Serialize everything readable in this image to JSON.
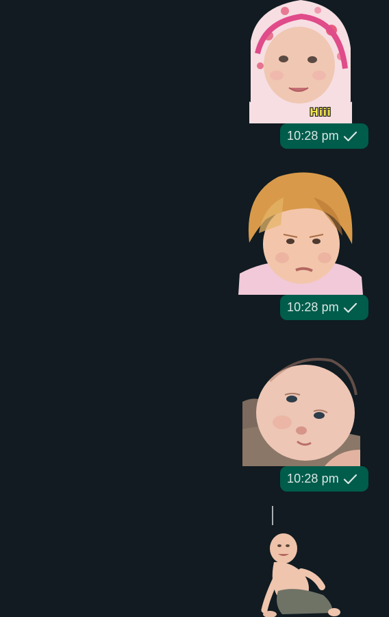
{
  "messages": [
    {
      "sticker": "baby-in-hood-sticker",
      "caption": "Hiii",
      "time": "10:28 pm",
      "status_icon": "single-check-icon"
    },
    {
      "sticker": "blond-baby-frowning-sticker",
      "time": "10:28 pm",
      "status_icon": "single-check-icon"
    },
    {
      "sticker": "newborn-lying-sticker",
      "time": "10:28 pm",
      "status_icon": "single-check-icon"
    },
    {
      "sticker": "sitting-baby-crying-sticker"
    }
  ],
  "colors": {
    "background": "#111b21",
    "timestamp_bubble": "#005c4b",
    "timestamp_text": "#d9e7e4"
  }
}
